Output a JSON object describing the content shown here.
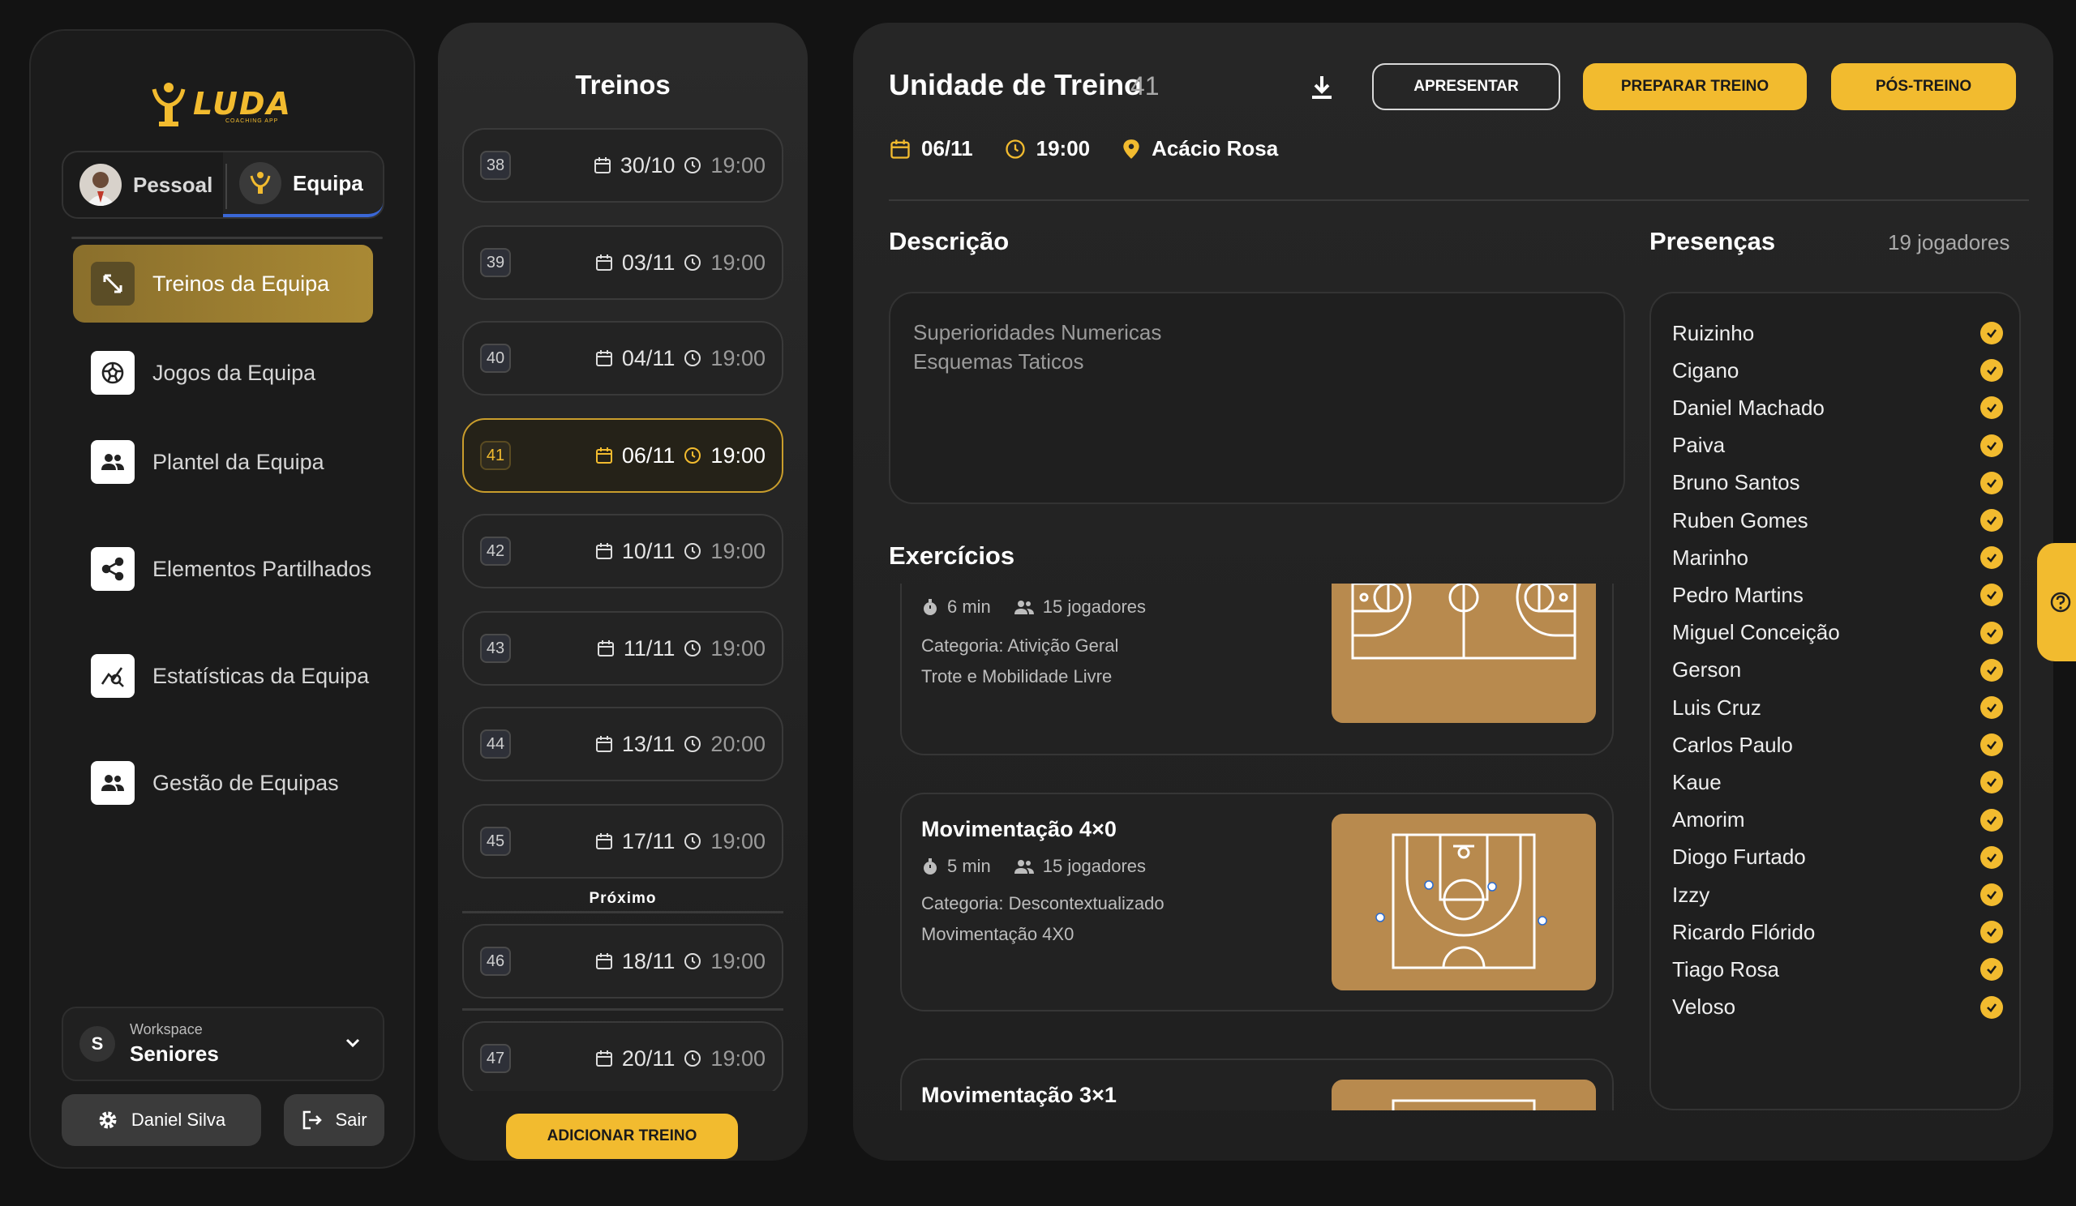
{
  "brand": {
    "name": "LUDA",
    "tagline": "COACHING APP"
  },
  "modes": [
    {
      "label": "Pessoal"
    },
    {
      "label": "Equipa"
    }
  ],
  "nav": [
    {
      "label": "Treinos da Equipa",
      "icon": "arrows-expand-icon"
    },
    {
      "label": "Jogos da Equipa",
      "icon": "ball-icon"
    },
    {
      "label": "Plantel da Equipa",
      "icon": "people-icon"
    },
    {
      "label": "Elementos Partilhados",
      "icon": "share-icon"
    },
    {
      "label": "Estatísticas da Equipa",
      "icon": "stats-icon"
    },
    {
      "label": "Gestão de Equipas",
      "icon": "people-icon"
    }
  ],
  "workspace": {
    "label": "Workspace",
    "badge": "S",
    "name": "Seniores"
  },
  "user": {
    "name": "Daniel Silva",
    "logout": "Sair"
  },
  "list": {
    "title": "Treinos",
    "next_label": "Próximo",
    "add_label": "ADICIONAR TREINO",
    "items": [
      {
        "num": "38",
        "date": "30/10",
        "time": "19:00"
      },
      {
        "num": "39",
        "date": "03/11",
        "time": "19:00"
      },
      {
        "num": "40",
        "date": "04/11",
        "time": "19:00"
      },
      {
        "num": "41",
        "date": "06/11",
        "time": "19:00"
      },
      {
        "num": "42",
        "date": "10/11",
        "time": "19:00"
      },
      {
        "num": "43",
        "date": "11/11",
        "time": "19:00"
      },
      {
        "num": "44",
        "date": "13/11",
        "time": "20:00"
      },
      {
        "num": "45",
        "date": "17/11",
        "time": "19:00"
      },
      {
        "num": "46",
        "date": "18/11",
        "time": "19:00"
      },
      {
        "num": "47",
        "date": "20/11",
        "time": "19:00"
      }
    ]
  },
  "session": {
    "title": "Unidade de Treino",
    "number": "41",
    "date": "06/11",
    "time": "19:00",
    "location": "Acácio Rosa",
    "buttons": {
      "present": "APRESENTAR",
      "prepare": "PREPARAR TREINO",
      "post": "PÓS-TREINO"
    },
    "description_title": "Descrição",
    "description_lines": [
      "Superioridades Numericas",
      "Esquemas Taticos"
    ],
    "exercises_title": "Exercícios",
    "exercises": [
      {
        "name": "",
        "duration": "6 min",
        "players": "15 jogadores",
        "category": "Categoria: Ativição Geral",
        "detail": "Trote e Mobilidade Livre"
      },
      {
        "name": "Movimentação 4×0",
        "duration": "5 min",
        "players": "15 jogadores",
        "category": "Categoria: Descontextualizado",
        "detail": "Movimentação 4X0"
      },
      {
        "name": "Movimentação 3×1"
      }
    ],
    "presences_title": "Presenças",
    "presences_count": "19 jogadores",
    "players": [
      "Ruizinho",
      "Cigano",
      "Daniel Machado",
      "Paiva",
      "Bruno Santos",
      "Ruben Gomes",
      "Marinho",
      "Pedro Martins",
      "Miguel Conceição",
      "Gerson",
      "Luis Cruz",
      "Carlos Paulo",
      "Kaue",
      "Amorim",
      "Diogo Furtado",
      "Izzy",
      "Ricardo Flórido",
      "Tiago Rosa",
      "Veloso"
    ]
  },
  "colors": {
    "accent": "#f2bb2f",
    "court": "#b88a4e",
    "background": "#131313"
  }
}
